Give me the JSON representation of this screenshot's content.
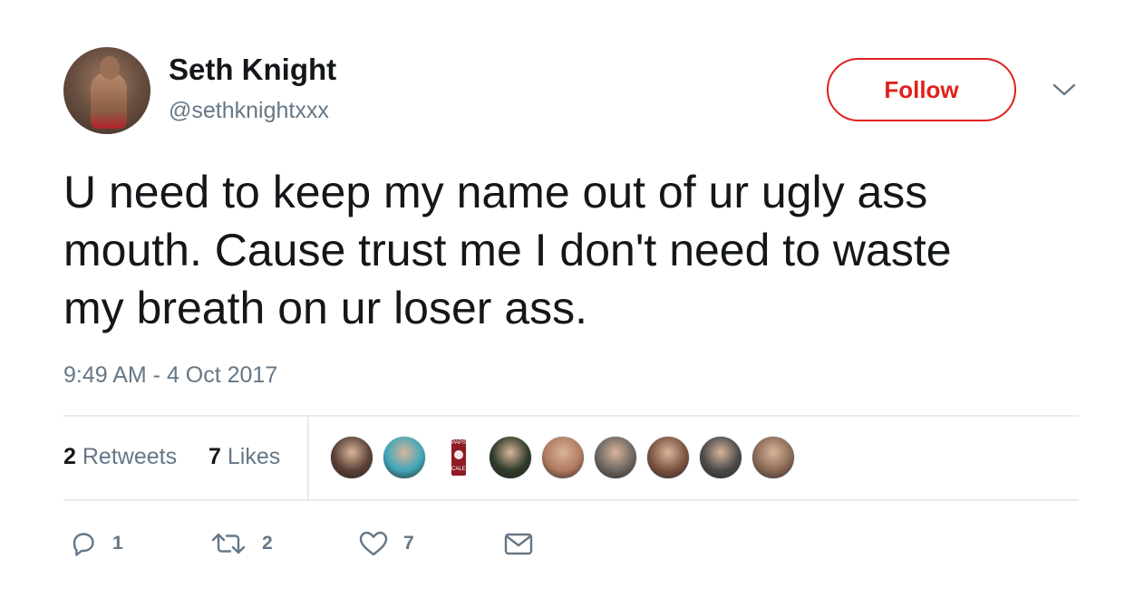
{
  "author": {
    "name": "Seth Knight",
    "handle": "@sethknightxxx"
  },
  "follow_button": {
    "label": "Follow",
    "color": "#e0211d"
  },
  "tweet": {
    "text": "U need to keep my name out of ur ugly ass\nmouth.  Cause trust me I don't need to waste\nmy breath on ur loser ass.",
    "timestamp": "9:49 AM - 4 Oct 2017"
  },
  "stats": {
    "retweets_count": "2",
    "retweets_label": "Retweets",
    "likes_count": "7",
    "likes_label": "Likes"
  },
  "likers": [
    {
      "icon": "liker-avatar",
      "color": "#5a4034"
    },
    {
      "icon": "liker-avatar",
      "color": "#3fa6b8"
    },
    {
      "icon": "liker-avatar-paps-caleb",
      "color": "#8e1a22",
      "line1": "PAPS",
      "line2": "CALEB"
    },
    {
      "icon": "liker-avatar",
      "color": "#2e3b2a"
    },
    {
      "icon": "liker-avatar",
      "color": "#b07a5e"
    },
    {
      "icon": "liker-avatar",
      "color": "#6b6660"
    },
    {
      "icon": "liker-avatar",
      "color": "#7a5340"
    },
    {
      "icon": "liker-avatar",
      "color": "#4a4a4a"
    },
    {
      "icon": "liker-avatar",
      "color": "#8a6a55"
    }
  ],
  "actions": {
    "reply_count": "1",
    "retweet_count": "2",
    "like_count": "7"
  },
  "colors": {
    "text_primary": "#14171a",
    "text_secondary": "#657786",
    "divider": "#e6ecf0"
  }
}
